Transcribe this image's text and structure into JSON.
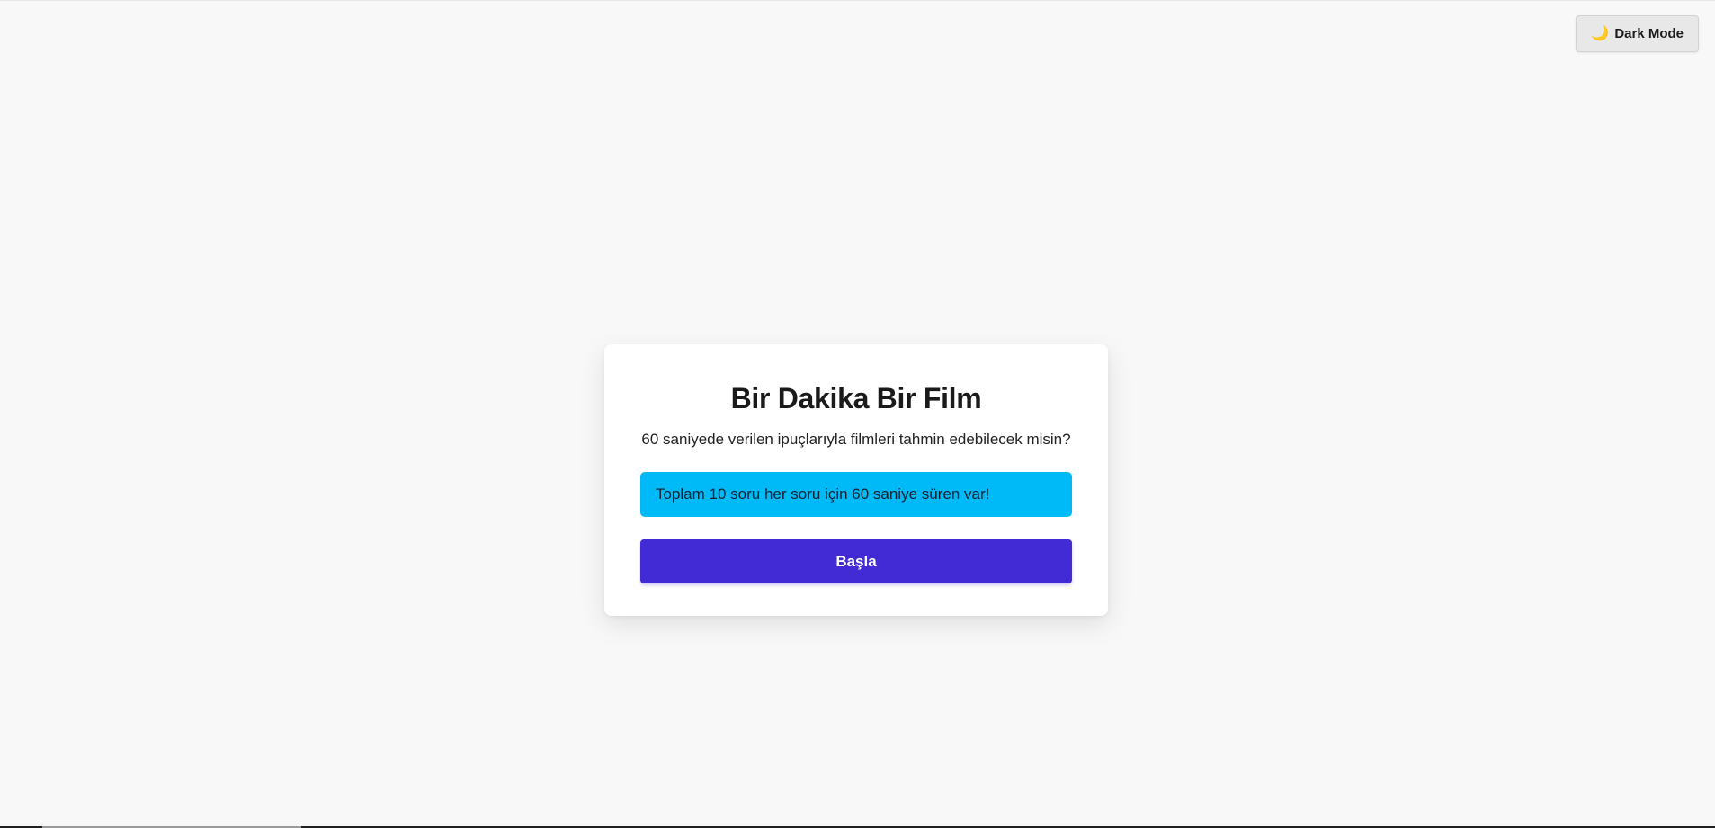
{
  "header": {
    "theme_toggle_icon": "crescent-moon-icon",
    "theme_toggle_glyph": "🌙",
    "theme_toggle_label": "Dark Mode"
  },
  "card": {
    "title": "Bir Dakika Bir Film",
    "subtitle": "60 saniyede verilen ipuçlarıyla filmleri tahmin edebilecek misin?",
    "info_text": "Toplam 10 soru her soru için 60 saniye süren var!",
    "start_label": "Başla"
  },
  "colors": {
    "background": "#f8f8f8",
    "info_box": "#00b9f7",
    "primary_button": "#422ad5"
  }
}
